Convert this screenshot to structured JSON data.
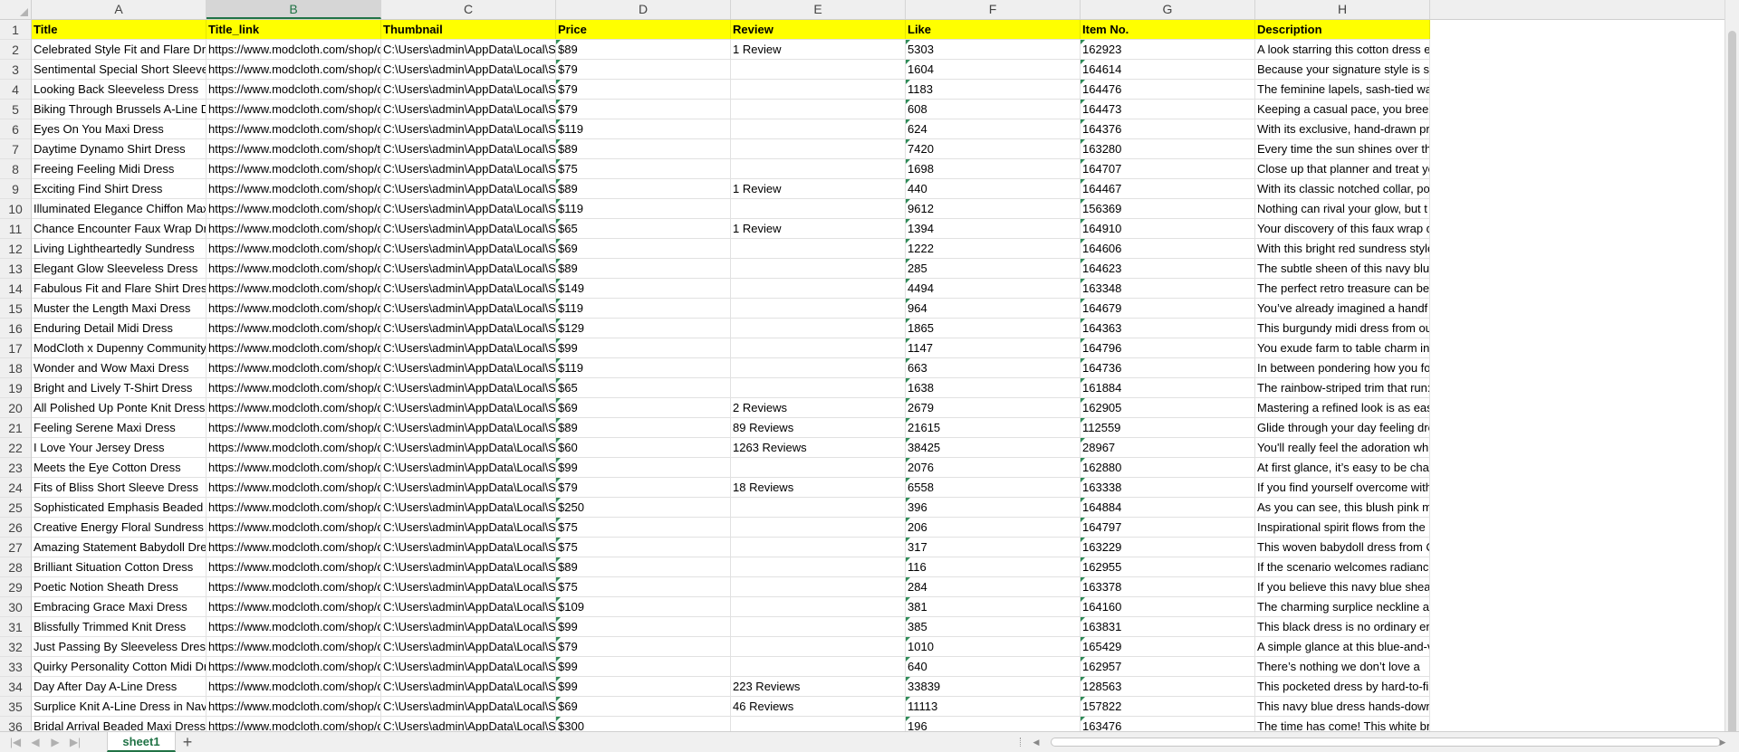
{
  "columns": [
    {
      "letter": "A",
      "header": "Title"
    },
    {
      "letter": "B",
      "header": "Title_link"
    },
    {
      "letter": "C",
      "header": "Thumbnail"
    },
    {
      "letter": "D",
      "header": "Price"
    },
    {
      "letter": "E",
      "header": "Review"
    },
    {
      "letter": "F",
      "header": "Like"
    },
    {
      "letter": "G",
      "header": "Item No."
    },
    {
      "letter": "H",
      "header": "Description"
    }
  ],
  "selected_column": "B",
  "rows": [
    [
      "Celebrated Style Fit and Flare Dress",
      "https://www.modcloth.com/shop/dres",
      "C:\\Users\\admin\\AppData\\Local\\Scrape",
      "$89",
      "1 Review",
      "5303",
      "162923",
      "A look starring this cotton dress e"
    ],
    [
      "Sentimental Special Short Sleeve Dres",
      "https://www.modcloth.com/shop/dres",
      "C:\\Users\\admin\\AppData\\Local\\Scrape",
      "$79",
      "",
      "1604",
      "164614",
      "Because your signature style is so"
    ],
    [
      "Looking Back Sleeveless Dress",
      "https://www.modcloth.com/shop/dres",
      "C:\\Users\\admin\\AppData\\Local\\Scrape",
      "$79",
      "",
      "1183",
      "164476",
      "The feminine lapels, sash-tied wais"
    ],
    [
      "Biking Through Brussels A-Line Dress",
      "https://www.modcloth.com/shop/dres",
      "C:\\Users\\admin\\AppData\\Local\\Scrape",
      "$79",
      "",
      "608",
      "164473",
      "Keeping a casual pace, you breeze"
    ],
    [
      "Eyes On You Maxi Dress",
      "https://www.modcloth.com/shop/dres",
      "C:\\Users\\admin\\AppData\\Local\\Scrape",
      "$119",
      "",
      "624",
      "164376",
      "With its exclusive, hand-drawn pri"
    ],
    [
      "Daytime Dynamo Shirt Dress",
      "https://www.modcloth.com/shop/tops",
      "C:\\Users\\admin\\AppData\\Local\\Scrape",
      "$89",
      "",
      "7420",
      "163280",
      "Every time the sun shines over the"
    ],
    [
      "Freeing Feeling Midi Dress",
      "https://www.modcloth.com/shop/dres",
      "C:\\Users\\admin\\AppData\\Local\\Scrape",
      "$75",
      "",
      "1698",
      "164707",
      "Close up that planner and treat yo"
    ],
    [
      "Exciting Find Shirt Dress",
      "https://www.modcloth.com/shop/dres",
      "C:\\Users\\admin\\AppData\\Local\\Scrape",
      "$89",
      "1 Review",
      "440",
      "164467",
      "With its classic notched collar, poc"
    ],
    [
      "Illuminated Elegance Chiffon Maxi Dre",
      "https://www.modcloth.com/shop/dres",
      "C:\\Users\\admin\\AppData\\Local\\Scrape",
      "$119",
      "",
      "9612",
      "156369",
      "Nothing can rival your glow, but t"
    ],
    [
      "Chance Encounter Faux Wrap Dress",
      "https://www.modcloth.com/shop/dres",
      "C:\\Users\\admin\\AppData\\Local\\Scrape",
      "$65",
      "1 Review",
      "1394",
      "164910",
      "Your discovery of this faux wrap d"
    ],
    [
      "Living Lightheartedly Sundress",
      "https://www.modcloth.com/shop/dres",
      "C:\\Users\\admin\\AppData\\Local\\Scrape",
      "$69",
      "",
      "1222",
      "164606",
      "With this bright red sundress style"
    ],
    [
      "Elegant Glow Sleeveless Dress",
      "https://www.modcloth.com/shop/dres",
      "C:\\Users\\admin\\AppData\\Local\\Scrape",
      "$89",
      "",
      "285",
      "164623",
      "The subtle sheen of this navy blue"
    ],
    [
      "Fabulous Fit and Flare Shirt Dress",
      "https://www.modcloth.com/shop/dres",
      "C:\\Users\\admin\\AppData\\Local\\Scrape",
      "$149",
      "",
      "4494",
      "163348",
      "The perfect retro treasure can be"
    ],
    [
      "Muster the Length Maxi Dress",
      "https://www.modcloth.com/shop/dres",
      "C:\\Users\\admin\\AppData\\Local\\Scrape",
      "$119",
      "",
      "964",
      "164679",
      "You’ve already imagined a handf"
    ],
    [
      "Enduring Detail Midi Dress",
      "https://www.modcloth.com/shop/dres",
      "C:\\Users\\admin\\AppData\\Local\\Scrape",
      "$129",
      "",
      "1865",
      "164363",
      "This burgundy midi dress from ou"
    ],
    [
      "ModCloth x Dupenny Community Bru",
      "https://www.modcloth.com/shop/dres",
      "C:\\Users\\admin\\AppData\\Local\\Scrape",
      "$99",
      "",
      "1147",
      "164796",
      "You exude farm to table charm in"
    ],
    [
      "Wonder and Wow Maxi Dress",
      "https://www.modcloth.com/shop/dres",
      "C:\\Users\\admin\\AppData\\Local\\Scrape",
      "$119",
      "",
      "663",
      "164736",
      "In between pondering how you fo"
    ],
    [
      "Bright and Lively T-Shirt Dress",
      "https://www.modcloth.com/shop/dres",
      "C:\\Users\\admin\\AppData\\Local\\Scrape",
      "$65",
      "",
      "1638",
      "161884",
      "The rainbow-striped trim that run:"
    ],
    [
      "All Polished Up Ponte Knit Dress",
      "https://www.modcloth.com/shop/dres",
      "C:\\Users\\admin\\AppData\\Local\\Scrape",
      "$69",
      "2 Reviews",
      "2679",
      "162905",
      "Mastering a refined look is as easy"
    ],
    [
      "Feeling Serene Maxi Dress",
      "https://www.modcloth.com/shop/dres",
      "C:\\Users\\admin\\AppData\\Local\\Scrape",
      "$89",
      "89 Reviews",
      "21615",
      "112559",
      "Glide through your day feeling dre"
    ],
    [
      "I Love Your Jersey Dress",
      "https://www.modcloth.com/shop/dres",
      "C:\\Users\\admin\\AppData\\Local\\Scrape",
      "$60",
      "1263 Reviews",
      "38425",
      "28967",
      "You'll really feel the adoration whi"
    ],
    [
      "Meets the Eye Cotton Dress",
      "https://www.modcloth.com/shop/dres",
      "C:\\Users\\admin\\AppData\\Local\\Scrape",
      "$99",
      "",
      "2076",
      "162880",
      "At first glance, it’s easy to be cha"
    ],
    [
      "Fits of Bliss Short Sleeve Dress",
      "https://www.modcloth.com/shop/dres",
      "C:\\Users\\admin\\AppData\\Local\\Scrape",
      "$79",
      "18 Reviews",
      "6558",
      "163338",
      "If you find yourself overcome with"
    ],
    [
      "Sophisticated Emphasis Beaded Maxi I",
      "https://www.modcloth.com/shop/dres",
      "C:\\Users\\admin\\AppData\\Local\\Scrape",
      "$250",
      "",
      "396",
      "164884",
      "As you can see, this blush pink ma"
    ],
    [
      "Creative Energy Floral Sundress",
      "https://www.modcloth.com/shop/dres",
      "C:\\Users\\admin\\AppData\\Local\\Scrape",
      "$75",
      "",
      "206",
      "164797",
      "Inspirational spirit flows from the"
    ],
    [
      "Amazing Statement Babydoll Dress",
      "https://www.modcloth.com/shop/dres",
      "C:\\Users\\admin\\AppData\\Local\\Scrape",
      "$75",
      "",
      "317",
      "163229",
      "This woven babydoll dress from C"
    ],
    [
      "Brilliant Situation Cotton Dress",
      "https://www.modcloth.com/shop/dres",
      "C:\\Users\\admin\\AppData\\Local\\Scrape",
      "$89",
      "",
      "116",
      "162955",
      "If the scenario welcomes radiance"
    ],
    [
      "Poetic Notion Sheath Dress",
      "https://www.modcloth.com/shop/dres",
      "C:\\Users\\admin\\AppData\\Local\\Scrape",
      "$75",
      "",
      "284",
      "163378",
      "If you believe this navy blue sheat"
    ],
    [
      "Embracing Grace Maxi Dress",
      "https://www.modcloth.com/shop/dres",
      "C:\\Users\\admin\\AppData\\Local\\Scrape",
      "$109",
      "",
      "381",
      "164160",
      "The charming surplice neckline an"
    ],
    [
      "Blissfully Trimmed Knit Dress",
      "https://www.modcloth.com/shop/dres",
      "C:\\Users\\admin\\AppData\\Local\\Scrape",
      "$99",
      "",
      "385",
      "163831",
      "This black dress is no ordinary ens"
    ],
    [
      "Just Passing By Sleeveless Dress",
      "https://www.modcloth.com/shop/dres",
      "C:\\Users\\admin\\AppData\\Local\\Scrape",
      "$79",
      "",
      "1010",
      "165429",
      "A simple glance at this blue-and-v"
    ],
    [
      "Quirky Personality Cotton Midi Dress",
      "https://www.modcloth.com/shop/dres",
      "C:\\Users\\admin\\AppData\\Local\\Scrape",
      "$99",
      "",
      "640",
      "162957",
      "There’s nothing we don’t love a"
    ],
    [
      "Day After Day A-Line Dress",
      "https://www.modcloth.com/shop/dres",
      "C:\\Users\\admin\\AppData\\Local\\Scrape",
      "$99",
      "223 Reviews",
      "33839",
      "128563",
      "This pocketed dress by hard-to-fir"
    ],
    [
      "Surplice Knit A-Line Dress in Navy Din",
      "https://www.modcloth.com/shop/dres",
      "C:\\Users\\admin\\AppData\\Local\\Scrape",
      "$69",
      "46 Reviews",
      "11113",
      "157822",
      "This navy blue dress hands-down"
    ],
    [
      "Bridal Arrival Beaded Maxi Dress",
      "https://www.modcloth.com/shop/dres",
      "C:\\Users\\admin\\AppData\\Local\\Scrape",
      "$300",
      "",
      "196",
      "163476",
      "The time has come! This white bric"
    ]
  ],
  "sheet_tab": "sheet1",
  "add_sheet_label": "+",
  "icons": {
    "nav_first": "nav-first-icon",
    "nav_prev": "nav-prev-icon",
    "nav_next": "nav-next-icon",
    "nav_last": "nav-last-icon",
    "scroll_left": "scroll-left-icon",
    "scroll_right": "scroll-right-icon"
  },
  "colors": {
    "header_fill": "#ffff00",
    "accent": "#217346",
    "comment_indicator": "#2e8b57"
  }
}
